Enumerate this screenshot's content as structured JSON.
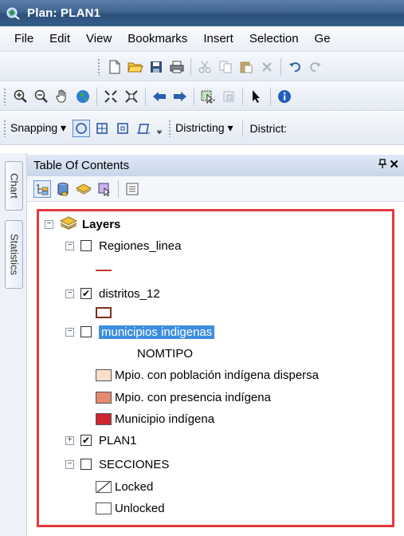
{
  "window": {
    "title": "Plan: PLAN1"
  },
  "menu": [
    "File",
    "Edit",
    "View",
    "Bookmarks",
    "Insert",
    "Selection",
    "Ge"
  ],
  "toolbar3": {
    "snapping_label": "Snapping ▾",
    "districting_label": "Districting ▾",
    "district_label": "District:"
  },
  "side_tabs": {
    "chart": "Chart",
    "statistics": "Statistics"
  },
  "toc": {
    "title": "Table Of Contents",
    "pin": "Θ",
    "close": "✕",
    "root": {
      "label": "Layers",
      "expander": "−"
    },
    "layers": [
      {
        "label": "Regiones_linea",
        "checked": "",
        "expander": "−"
      },
      {
        "label": "distritos_12",
        "checked": "✔",
        "expander": "−"
      },
      {
        "label": "municipios indigenas",
        "checked": "",
        "expander": "−",
        "field": "NOMTIPO"
      },
      {
        "label": "PLAN1",
        "checked": "✔",
        "expander": "+"
      },
      {
        "label": "SECCIONES",
        "checked": "",
        "expander": "−"
      }
    ],
    "legend": {
      "regiones_color": "#c0392b",
      "distritos_color": "#7a3020",
      "municipios": [
        {
          "label": "Mpio. con población indígena dispersa",
          "color": "#fbe0cc"
        },
        {
          "label": "Mpio. con presencia indígena",
          "color": "#e48a70"
        },
        {
          "label": "Municipio indígena",
          "color": "#cc2630"
        }
      ],
      "secciones": [
        {
          "label": "Locked"
        },
        {
          "label": "Unlocked"
        }
      ]
    }
  },
  "colors": {
    "highlight": "#e53a3f",
    "selection": "#3d8ee0",
    "titlebar": "#3f6690"
  }
}
